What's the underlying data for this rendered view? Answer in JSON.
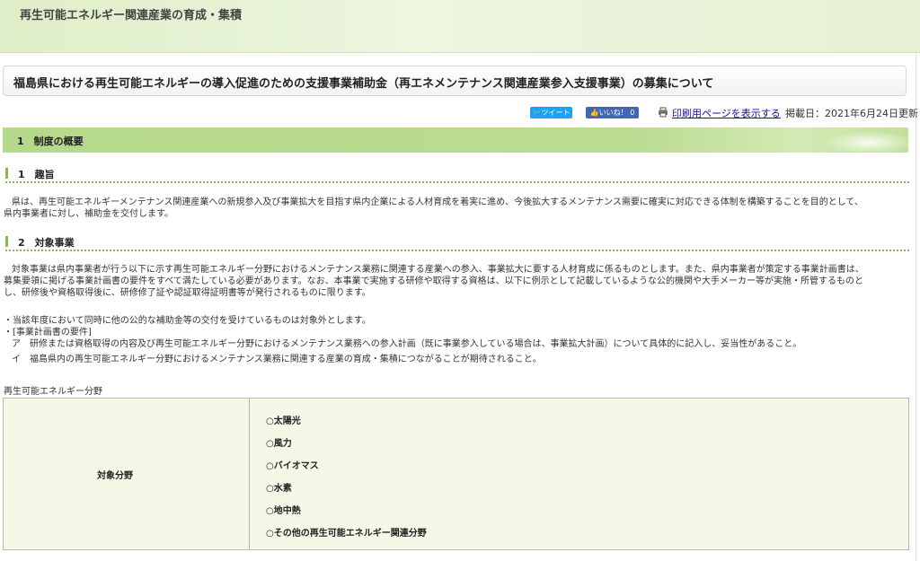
{
  "banner": {
    "title": "再生可能エネルギー関連産業の育成・集積"
  },
  "page": {
    "title": "福島県における再生可能エネルギーの導入促進のための支援事業補助金（再エネメンテナンス関連産業参入支援事業）の募集について"
  },
  "social": {
    "tweet": "ツイート",
    "like": "いいね！ 0"
  },
  "print": {
    "link": "印刷用ページを表示する"
  },
  "published": "掲載日：2021年6月24日更新",
  "section1": {
    "heading": "1　制度の概要"
  },
  "sub1": {
    "heading": "1　趣旨",
    "lines": [
      "県は、再生可能エネルギーメンテナンス関連産業への新規参入及び事業拡大を目指す県内企業による人材育成を着実に進め、今後拡大するメンテナンス需要に確実に対応できる体制を構築することを目的として、",
      "県内事業者に対し、補助金を交付します。"
    ]
  },
  "sub2": {
    "heading": "2　対象事業",
    "lines": [
      "対象事業は県内事業者が行う以下に示す再生可能エネルギー分野におけるメンテナンス業務に関連する産業への参入、事業拡大に要する人材育成に係るものとします。また、県内事業者が策定する事業計画書は、",
      "募集要領に掲げる事業計画書の要件をすべて満たしている必要があります。なお、本事業で実施する研修や取得する資格は、以下に例示として記載しているような公的機関や大手メーカー等が実施・所管するものと",
      "し、研修後や資格取得後に、研修修了証や認証取得証明書等が発行されるものに限ります。"
    ],
    "notes": [
      "・当該年度において同時に他の公的な補助金等の交付を受けているものは対象外とします。",
      "・[事業計画書の要件]",
      "ア　研修または資格取得の内容及び再生可能エネルギー分野におけるメンテナンス業務への参入計画（既に事業参入している場合は、事業拡大計画）について具体的に記入し、妥当性があること。",
      "イ　福島県内の再生可能エネルギー分野におけるメンテナンス業務に関連する産業の育成・集積につながることが期待されること。"
    ]
  },
  "fields": {
    "caption": "再生可能エネルギー分野",
    "label": "対象分野",
    "items": [
      "○太陽光",
      "○風力",
      "○バイオマス",
      "○水素",
      "○地中熱",
      "○その他の再生可能エネルギー関連分野"
    ]
  }
}
